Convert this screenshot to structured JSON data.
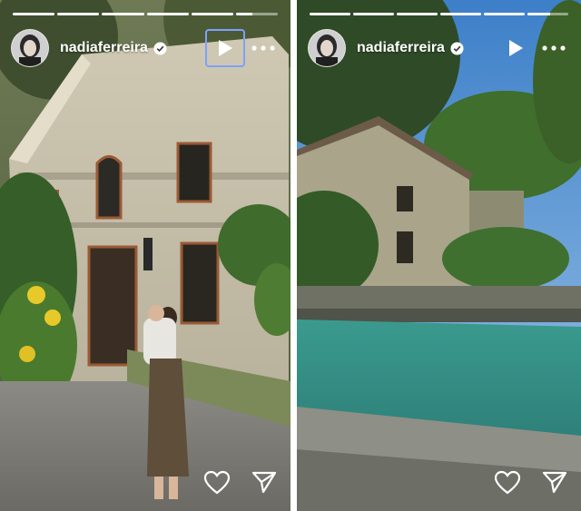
{
  "stories": [
    {
      "username": "nadiaferreira",
      "verified": true,
      "progress_segments": 6,
      "progress_active_index": 0,
      "play_focused": true,
      "icons": {
        "play": "play-icon",
        "more": "more-dots-icon",
        "like": "heart-icon",
        "share": "send-icon",
        "verified": "verified-badge-icon"
      }
    },
    {
      "username": "nadiaferreira",
      "verified": true,
      "progress_segments": 6,
      "progress_active_index": 1,
      "play_focused": false,
      "icons": {
        "play": "play-icon",
        "more": "more-dots-icon",
        "like": "heart-icon",
        "share": "send-icon",
        "verified": "verified-badge-icon"
      }
    }
  ]
}
